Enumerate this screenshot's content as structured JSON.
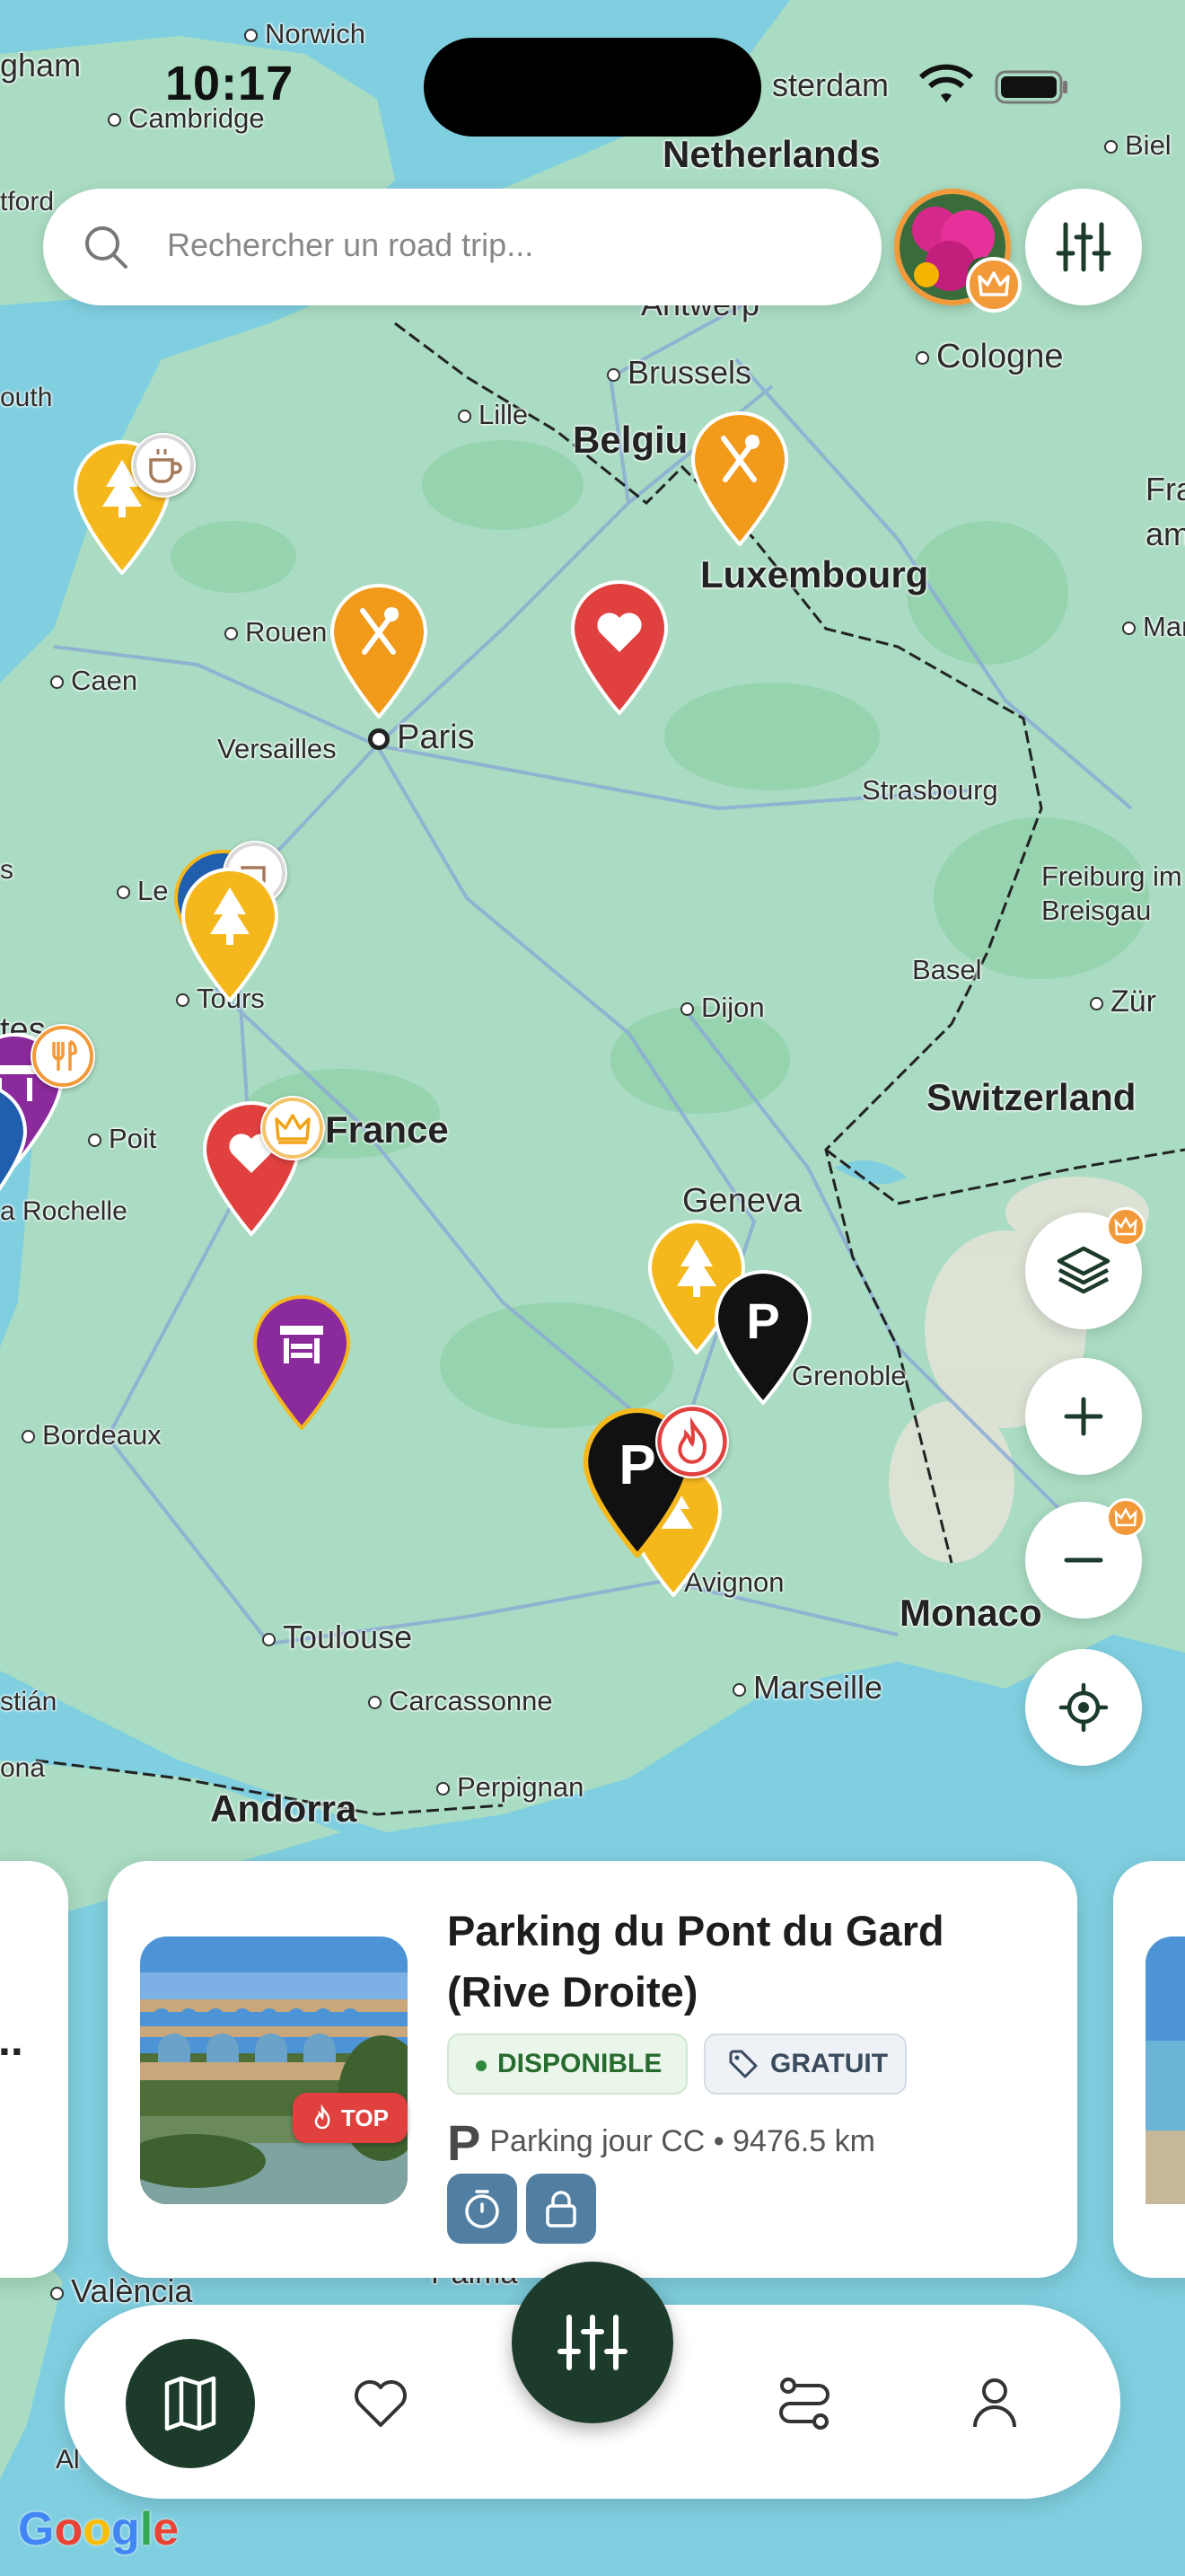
{
  "status_bar": {
    "time": "10:17"
  },
  "search": {
    "placeholder": "Rechercher un road trip..."
  },
  "map": {
    "labels": {
      "norwich": "Norwich",
      "cambridge": "Cambridge",
      "gham": "gham",
      "tford": "tford",
      "outh": "outh",
      "sterdam": "sterdam",
      "biel": "Biel",
      "netherlands": "Netherlands",
      "antwerp": "Antwerp",
      "brussels": "Brussels",
      "lille": "Lille",
      "cologne": "Cologne",
      "belgium": "Belgiu",
      "fra": "Fra",
      "am": "am",
      "luxembourg": "Luxembourg",
      "mann": "Mann",
      "rouen": "Rouen",
      "caen": "Caen",
      "versailles": "Versailles",
      "paris": "Paris",
      "strasbourg": "Strasbourg",
      "le": "Le",
      "tours": "Tours",
      "freiburg": "Freiburg im",
      "breisgau": "Breisgau",
      "basel": "Basel",
      "dijon": "Dijon",
      "zur": "Zür",
      "tes": "tes",
      "switzerland": "Switzerland",
      "poit": "Poit",
      "france": "France",
      "larochelle": "a Rochelle",
      "geneva": "Geneva",
      "grenoble": "Grenoble",
      "bordeaux": "Bordeaux",
      "avignon": "Avignon",
      "monaco": "Monaco",
      "toulouse": "Toulouse",
      "carcassonne": "Carcassonne",
      "marseille": "Marseille",
      "stian": "stián",
      "perpignan": "Perpignan",
      "ona": "ona",
      "andorra": "Andorra",
      "valencia": "València",
      "palma": "Palma",
      "al": "Al",
      "s": "s"
    }
  },
  "card": {
    "title_line1": "Parking du Pont du Gard",
    "title_line2": "(Rive Droite)",
    "badge_top": "TOP",
    "chip_available": "DISPONIBLE",
    "chip_free": "GRATUIT",
    "type_letter": "P",
    "meta": "Parking jour CC • 9476.5 km",
    "left_peek": ".."
  },
  "nav": {
    "items": [
      "map",
      "favorites",
      "filters",
      "routes",
      "profile"
    ]
  },
  "attribution": {
    "g1": "G",
    "g2": "o",
    "g3": "o",
    "g4": "g",
    "g5": "l",
    "g6": "e"
  },
  "colors": {
    "dark_green": "#1c3b2b",
    "orange": "#f29a3a",
    "yellow": "#f5b81c",
    "red": "#e0413f",
    "purple": "#8b2a9b",
    "blue": "#1f5fad",
    "black": "#111111"
  }
}
